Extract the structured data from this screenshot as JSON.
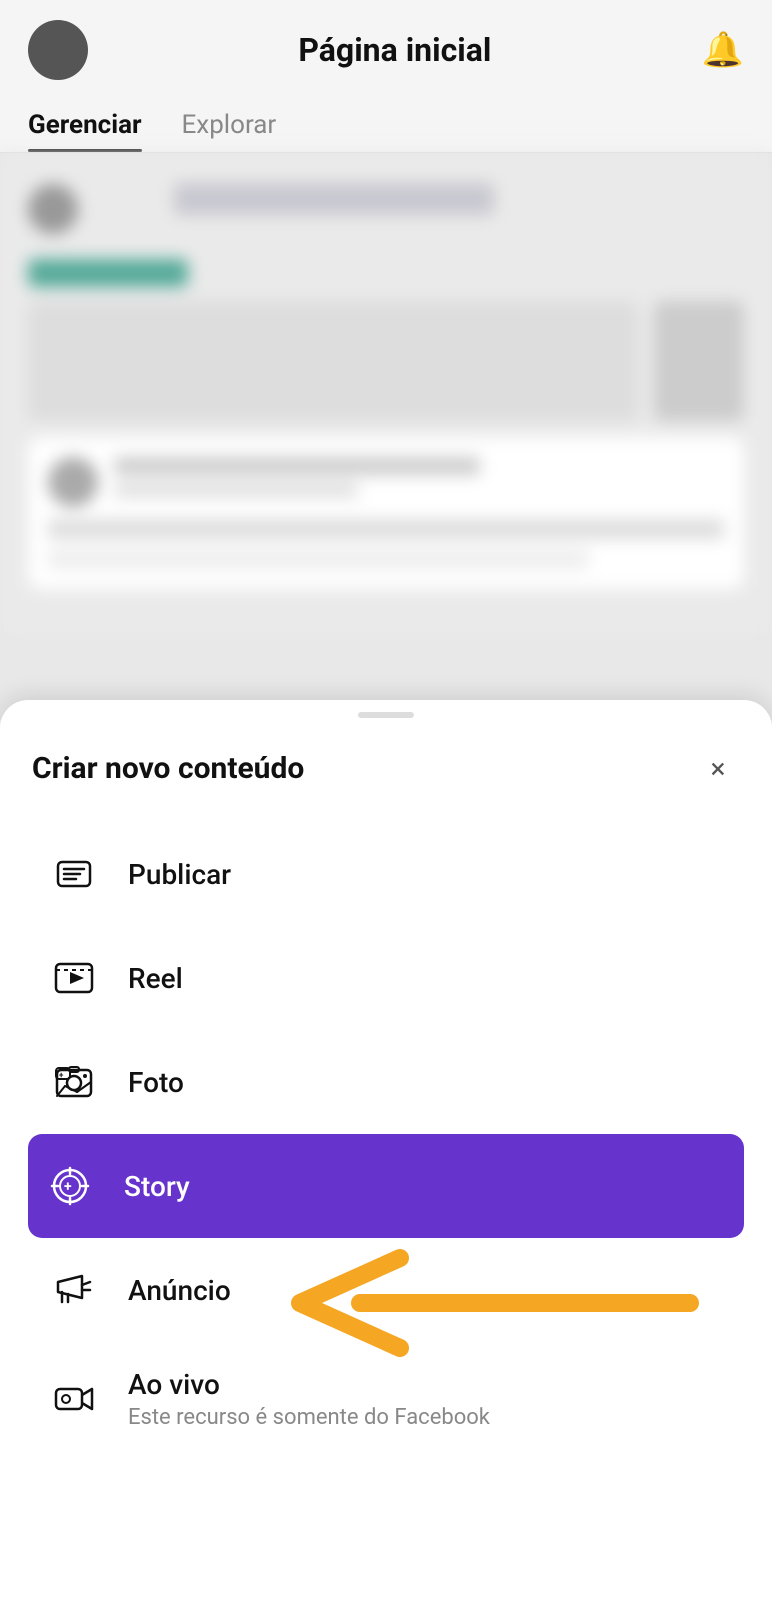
{
  "header": {
    "title": "Página inicial",
    "bell_icon": "🔔"
  },
  "tabs": {
    "active": "Gerenciar",
    "items": [
      {
        "label": "Gerenciar",
        "active": true
      },
      {
        "label": "Explorar",
        "active": false
      }
    ]
  },
  "sheet": {
    "title": "Criar novo conteúdo",
    "close_label": "×",
    "menu_items": [
      {
        "id": "publicar",
        "label": "Publicar",
        "sublabel": "",
        "highlighted": false
      },
      {
        "id": "reel",
        "label": "Reel",
        "sublabel": "",
        "highlighted": false
      },
      {
        "id": "foto",
        "label": "Foto",
        "sublabel": "",
        "highlighted": false
      },
      {
        "id": "story",
        "label": "Story",
        "sublabel": "",
        "highlighted": true
      },
      {
        "id": "anuncio",
        "label": "Anúncio",
        "sublabel": "",
        "highlighted": false
      },
      {
        "id": "ao-vivo",
        "label": "Ao vivo",
        "sublabel": "Este recurso é somente do Facebook",
        "highlighted": false
      }
    ]
  }
}
